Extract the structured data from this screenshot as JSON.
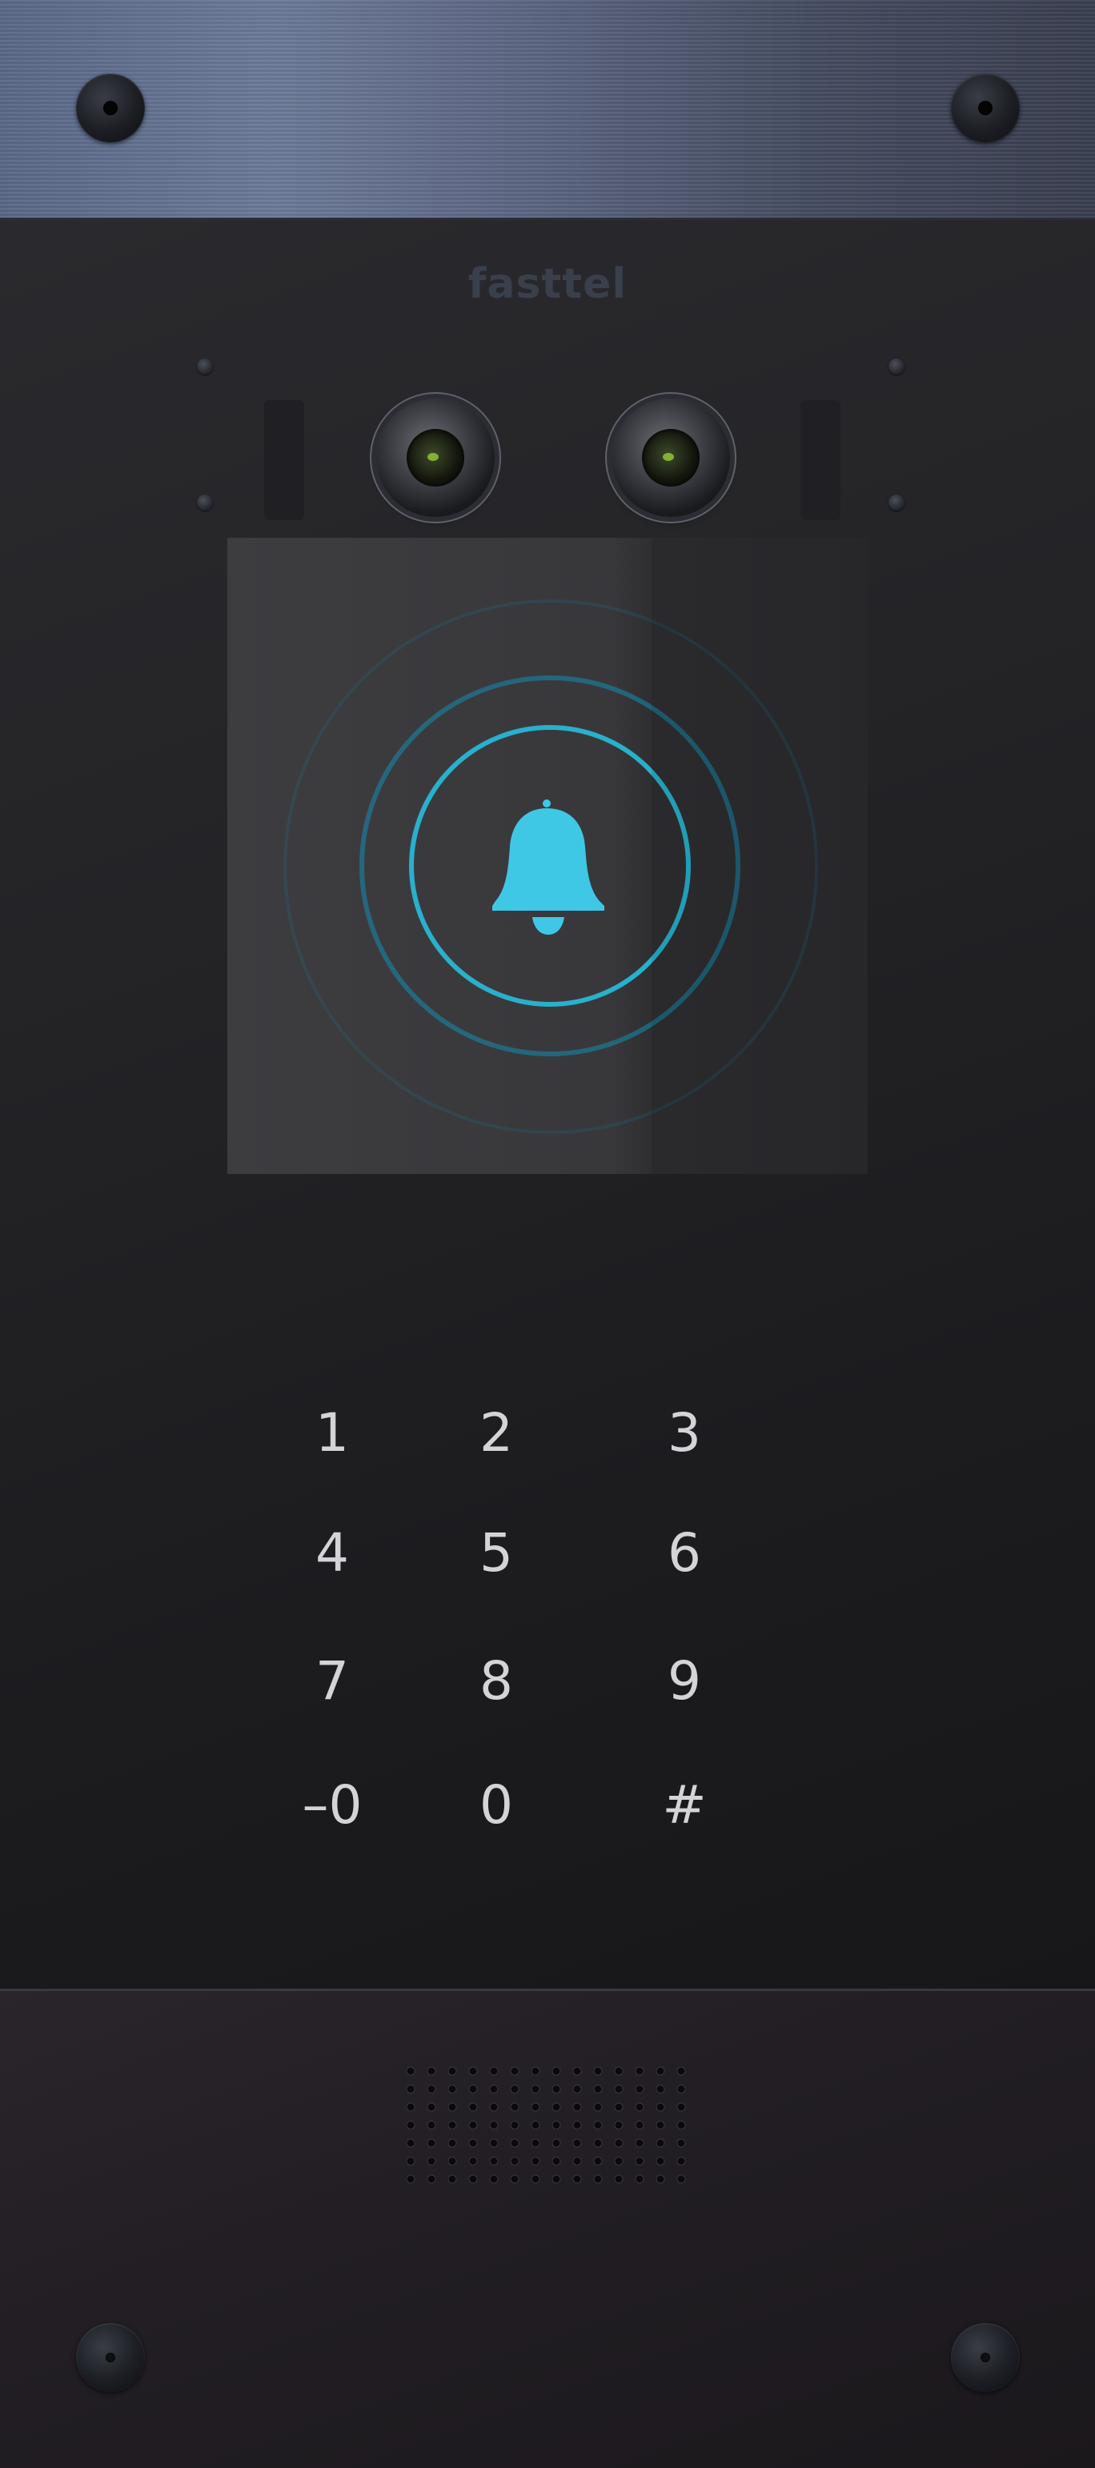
{
  "device": {
    "brand": "fasttel",
    "status_icon": "bell-icon",
    "colors": {
      "accent": "#3ec8e6",
      "ring": "#1ca6c8",
      "panel": "#1e1e21",
      "top_strip": "#5b6682",
      "key_text": "#d4d4d8"
    }
  },
  "keypad": {
    "keys": [
      "1",
      "2",
      "3",
      "4",
      "5",
      "6",
      "7",
      "8",
      "9",
      "–0",
      "0",
      "#"
    ]
  }
}
